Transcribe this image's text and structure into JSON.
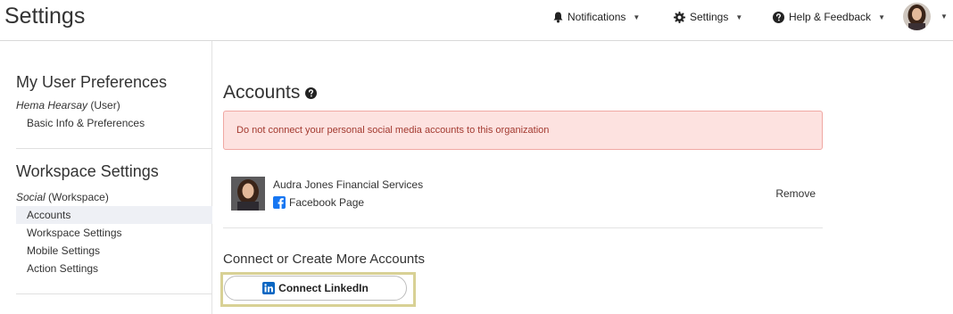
{
  "header": {
    "title": "Settings",
    "notifications_label": "Notifications",
    "settings_label": "Settings",
    "help_label": "Help & Feedback"
  },
  "sidebar": {
    "user_prefs_heading": "My User Preferences",
    "user_name": "Hema Hearsay",
    "user_role": "(User)",
    "user_links": [
      "Basic Info & Preferences"
    ],
    "workspace_heading": "Workspace Settings",
    "workspace_name": "Social",
    "workspace_role": "(Workspace)",
    "workspace_links": [
      "Accounts",
      "Workspace Settings",
      "Mobile Settings",
      "Action Settings"
    ],
    "active_link": "Accounts"
  },
  "main": {
    "title": "Accounts",
    "alert_text": "Do not connect your personal social media accounts to this organization",
    "accounts": [
      {
        "name": "Audra Jones Financial Services",
        "type": "Facebook Page",
        "action": "Remove"
      }
    ],
    "connect_heading": "Connect or Create More Accounts",
    "connect_button_label": "Connect LinkedIn"
  },
  "colors": {
    "alert_bg": "#fde2e0",
    "alert_border": "#f0a8a3",
    "alert_text": "#a33a30",
    "facebook_blue": "#1877f2",
    "linkedin_blue": "#0a66c2",
    "highlight_border": "#d8d195",
    "active_nav_bg": "#eef0f5"
  },
  "icons": {
    "notifications": "bell-icon",
    "settings": "gear-icon",
    "help": "question-circle-icon",
    "title_help": "question-circle-icon",
    "facebook": "facebook-icon",
    "linkedin": "linkedin-icon"
  }
}
